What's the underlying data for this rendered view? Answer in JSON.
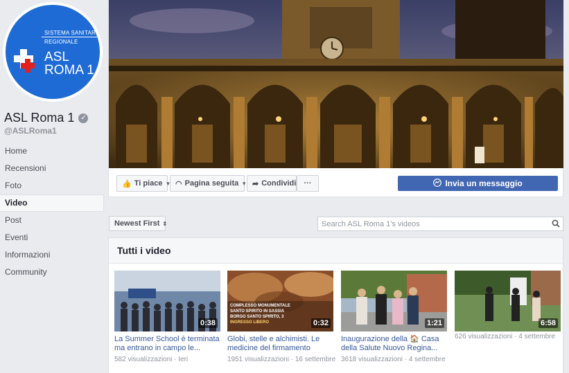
{
  "sidebar": {
    "avatar": {
      "line1": "SISTEMA SANITARIO",
      "line2": "REGIONALE",
      "asl": "ASL",
      "roma": "ROMA 1"
    },
    "page_name": "ASL Roma 1",
    "handle": "@ASLRoma1",
    "nav": [
      {
        "label": "Home"
      },
      {
        "label": "Recensioni"
      },
      {
        "label": "Foto"
      },
      {
        "label": "Video"
      },
      {
        "label": "Post"
      },
      {
        "label": "Eventi"
      },
      {
        "label": "Informazioni"
      },
      {
        "label": "Community"
      }
    ]
  },
  "actions": {
    "like": "Ti piace",
    "follow": "Pagina seguita",
    "share": "Condividi",
    "more": "···",
    "message": "Invia un messaggio"
  },
  "toolbar": {
    "sort": "Newest First",
    "search_placeholder": "Search ASL Roma 1's videos"
  },
  "videos": {
    "header": "Tutti i video",
    "items": [
      {
        "duration": "0:38",
        "title": "La Summer School è terminata ma entrano in campo le...",
        "meta": "582 visualizzazioni · Ieri"
      },
      {
        "duration": "0:32",
        "title": "Globi, stelle e alchimisti. Le medicine del firmamento",
        "meta": "1951 visualizzazioni · 16 settembre",
        "overlay": [
          "COMPLESSO MONUMENTALE",
          "SANTO SPIRITO IN SASSIA",
          "BORGO SANTO SPIRITO, 3",
          "INGRESSO LIBERO"
        ]
      },
      {
        "duration": "1:21",
        "title": "Inaugurazione della 🏠 Casa della Salute Nuovo Regina...",
        "meta": "3618 visualizzazioni · 4 settembre"
      },
      {
        "duration": "6:58",
        "title": "",
        "meta": "626 visualizzazioni · 4 settembre"
      }
    ]
  },
  "colors": {
    "brand_blue": "#4267b2",
    "link_blue": "#365899",
    "avatar_blue": "#1e6bd6",
    "cross_red": "#e3201b"
  }
}
